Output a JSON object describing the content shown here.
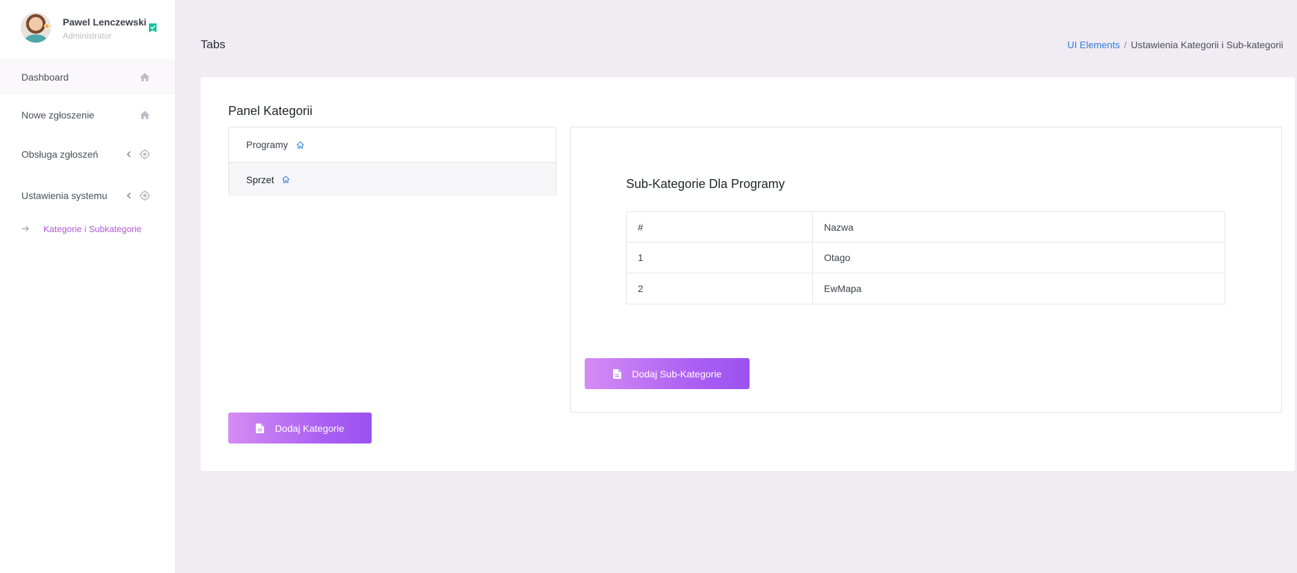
{
  "profile": {
    "name": "Pawel Lenczewski",
    "role": "Administrator"
  },
  "sidebar": {
    "items": [
      {
        "label": "Dashboard",
        "icon": "home-icon"
      },
      {
        "label": "Nowe zgłoszenie",
        "icon": "home-icon"
      },
      {
        "label": "Obsługa zgłoszeń",
        "icon": "target-icon"
      },
      {
        "label": "Ustawienia systemu",
        "icon": "target-icon"
      }
    ],
    "sub_item": {
      "label": "Kategorie i Subkategorie",
      "icon": "arrow-right-icon"
    }
  },
  "header": {
    "title": "Tabs",
    "breadcrumb": {
      "link": "UI Elements",
      "separator": "/",
      "current": "Ustawienia Kategorii i Sub-kategorii"
    }
  },
  "panel": {
    "title": "Panel Kategorii",
    "categories": [
      {
        "label": "Programy",
        "icon": "home-outline-icon"
      },
      {
        "label": "Sprzet",
        "icon": "home-outline-icon"
      }
    ],
    "add_category_label": "Dodaj Kategorie"
  },
  "subcategories": {
    "title": "Sub-Kategorie Dla Programy",
    "columns": [
      "#",
      "Nazwa"
    ],
    "rows": [
      [
        "1",
        "Otago"
      ],
      [
        "2",
        "EwMapa"
      ]
    ],
    "add_label": "Dodaj Sub-Kategorie"
  },
  "colors": {
    "accent_link": "#2f7ed8",
    "active_sub_item": "#b15bd6",
    "button_gradient_start": "#d58cf3",
    "button_gradient_end": "#9a52ef",
    "verified_badge": "#17c2a0",
    "page_background": "#f1ebf2"
  }
}
